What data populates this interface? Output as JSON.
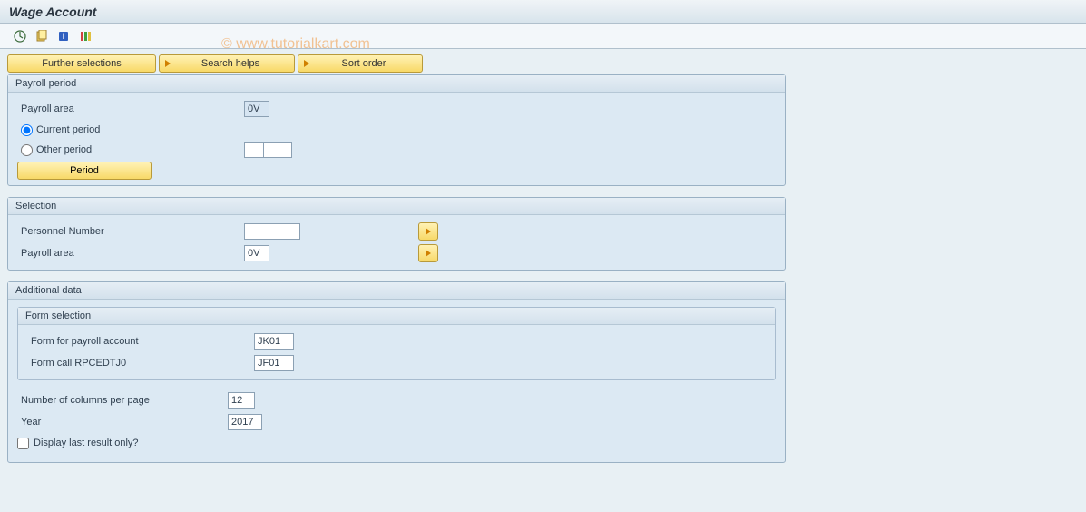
{
  "title": "Wage Account",
  "watermark": "© www.tutorialkart.com",
  "topButtons": {
    "furtherSelections": "Further selections",
    "searchHelps": "Search helps",
    "sortOrder": "Sort order"
  },
  "payrollPeriod": {
    "groupLabel": "Payroll period",
    "payrollAreaLabel": "Payroll area",
    "payrollAreaValue": "0V",
    "currentPeriodLabel": "Current period",
    "otherPeriodLabel": "Other period",
    "otherPeriodVal1": "",
    "otherPeriodVal2": "",
    "periodButton": "Period"
  },
  "selection": {
    "groupLabel": "Selection",
    "personnelNumberLabel": "Personnel Number",
    "personnelNumberValue": "",
    "payrollAreaLabel": "Payroll area",
    "payrollAreaValue": "0V"
  },
  "additionalData": {
    "groupLabel": "Additional data",
    "formSelection": {
      "groupLabel": "Form selection",
      "formPayrollAccountLabel": "Form for payroll account",
      "formPayrollAccountValue": "JK01",
      "formCallLabel": "Form call RPCEDTJ0",
      "formCallValue": "JF01"
    },
    "columnsLabel": "Number of columns per page",
    "columnsValue": "12",
    "yearLabel": "Year",
    "yearValue": "2017",
    "displayLastLabel": "Display last result only?"
  }
}
